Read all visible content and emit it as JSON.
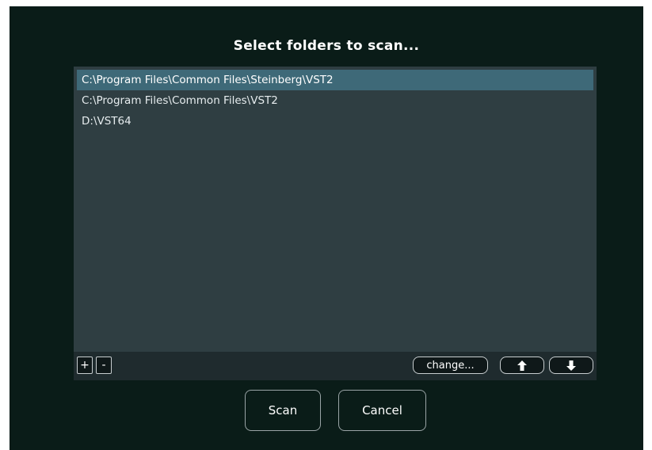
{
  "dialog": {
    "title": "Select folders to scan..."
  },
  "folders": [
    {
      "path": "C:\\Program Files\\Common Files\\Steinberg\\VST2",
      "selected": true
    },
    {
      "path": "C:\\Program Files\\Common Files\\VST2",
      "selected": false
    },
    {
      "path": "D:\\VST64",
      "selected": false
    }
  ],
  "toolbar": {
    "add_label": "+",
    "remove_label": "-",
    "change_label": "change...",
    "move_up_icon": "arrow-up-icon",
    "move_down_icon": "arrow-down-icon"
  },
  "actions": {
    "scan_label": "Scan",
    "cancel_label": "Cancel"
  },
  "colors": {
    "background": "#0a1c18",
    "panel": "#2f3e42",
    "selection": "#3e6978",
    "toolbar": "#1f2b2e"
  }
}
